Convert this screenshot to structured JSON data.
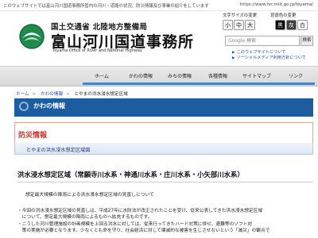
{
  "topbar": {
    "tagline": "このウェブサイトでは富山河川国道事務所管内の河川・道路の状況、防災情報及び事業の紹介をしています",
    "url": "https://www.hrr.mlit.go.jp/toyama/"
  },
  "logo": {
    "ministry": "国土交通省 北陸地方整備局",
    "office": "富山河川国道事務所",
    "office_en": "Toyama Office of River and National Highway"
  },
  "util": {
    "font_size_label": "文字サイズの変更",
    "font_sizes": [
      "小",
      "中",
      "大"
    ],
    "bg_color_label": "背景色の変更",
    "bg_colors": [
      "黒",
      "灰",
      "白"
    ],
    "search_placeholder": "Google 検索",
    "search_button": "検索",
    "links": [
      "このウェブサイトについて",
      "ソーシャルメディア利用方針について"
    ]
  },
  "nav": {
    "items": [
      "ホーム",
      "かわの情報",
      "みちの情報",
      "各種情報",
      "サイトマップ",
      "リンク"
    ]
  },
  "breadcrumb": {
    "items": [
      "ホーム",
      "かわの情報",
      "とやまの洪水浸水想定区域"
    ]
  },
  "section": {
    "title": "かわの情報"
  },
  "bousai": {
    "title": "防災情報",
    "sub": "とやまの洪水浸水想定区域図"
  },
  "content": {
    "heading": "洪水浸水想定区域（常願寺川水系・神通川水系・庄川水系・小矢部川水系）",
    "pill": "想定最大規模の降雨による洪水浸水想定区域の見直しについて",
    "paragraphs": [
      "・今回の洪水浸水想定区域の見直しは、平成27年に水防法が改正されたことを受け、従来公表してきた洪水浸水想定区域",
      "　について、想定最大規模の降雨によるものへ拡充するものです。",
      "・こうした河川管理施設の計画規模を上回る洪水に対しては、従来行ってきたハード対策に併せ、避難等のソフト対",
      "　策の実施が必要となります。少なくとも命を守り、社会経済に対して壊滅的な被害を生じさせないという「減災」の観点で"
    ]
  },
  "colors": {
    "primary_blue": "#1d5c9f",
    "nav_underline": "#4c80c0",
    "bousai_red": "#c33a2c"
  }
}
